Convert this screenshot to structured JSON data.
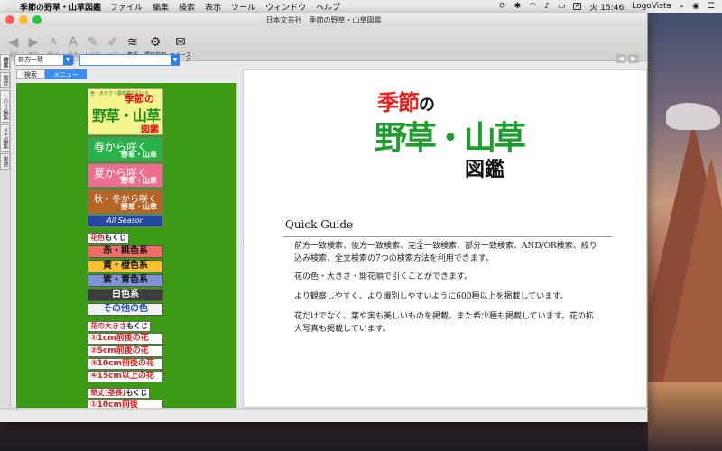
{
  "menubar": {
    "app": "季節の野草・山草図鑑",
    "items": [
      "ファイル",
      "編集",
      "検索",
      "表示",
      "ツール",
      "ウィンドウ",
      "ヘルプ"
    ],
    "clock": "火 15:46",
    "user": "LogoVista"
  },
  "window": {
    "title": "日本文芸社　季節の野草・山草図鑑"
  },
  "toolbar": {
    "buttons": [
      {
        "label": "戻る",
        "icon": "◀"
      },
      {
        "label": "進む",
        "icon": "▶"
      },
      {
        "label": "縮小",
        "icon": "A"
      },
      {
        "label": "拡大",
        "icon": "A"
      },
      {
        "label": "しおり",
        "icon": "✎"
      },
      {
        "label": "メモ",
        "icon": "✐"
      },
      {
        "label": "単語",
        "icon": "≋"
      },
      {
        "label": "環境設定",
        "icon": "⚙"
      },
      {
        "label": "ニュース",
        "icon": "✉"
      }
    ]
  },
  "search": {
    "mode": "前方一致",
    "input_value": ""
  },
  "subtabs": [
    "検索",
    "メニュー"
  ],
  "sidebar_tabs": [
    "検",
    "索",
    "履",
    "歴",
    "しおり編集",
    "メモ編集",
    "単語"
  ],
  "menu_panel": {
    "logo": {
      "small": "色・大きさ・開花順で引ける",
      "a": "季節の",
      "b": "野草・山草",
      "c": "図鑑"
    },
    "seasons": [
      {
        "big": "春から咲く",
        "sub": "野草・山草"
      },
      {
        "big": "夏から咲く",
        "sub": "野草・山草"
      },
      {
        "big": "秋・冬から咲く",
        "sub": "野草・山草"
      }
    ],
    "all_season": "All Season",
    "color_head": {
      "a": "花色",
      "b": "もくじ"
    },
    "colors": [
      "赤・桃色系",
      "黄・橙色系",
      "紫・青色系",
      "白色系",
      "その他の色"
    ],
    "size_head": {
      "a": "花の大きさ",
      "b": "もくじ"
    },
    "sizes": [
      "①1cm前後の花",
      "②5cm前後の花",
      "③10cm前後の花",
      "④15cm以上の花"
    ],
    "height_head": {
      "a": "草丈(茎長)",
      "b": "もくじ"
    },
    "heights": [
      "①10cm前後"
    ]
  },
  "content": {
    "title1": "季節",
    "title1_no": "の",
    "title2": "野草・山草",
    "title3": "図鑑",
    "heading": "Quick Guide",
    "paragraphs": [
      "前方一致検索、後方一致検索、完全一致検索、部分一致検索、AND/OR検索、絞り込み検索、全文検索の7つの検索方法を利用できます。",
      "花の色・大きさ・開花順で引くことができます。",
      "より観察しやすく、より識別しやすいように600種以上を掲載しています。",
      "花だけでなく、葉や実も美しいものを掲載。また希少種も掲載しています。花の拡大写真も掲載しています。"
    ]
  }
}
